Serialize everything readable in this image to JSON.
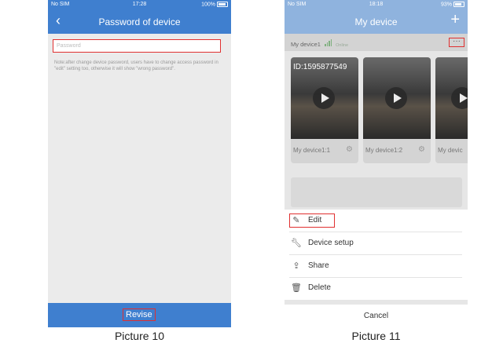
{
  "picture10": {
    "status": {
      "carrier": "No SIM",
      "wifi_icon": "wifi-icon",
      "time": "17:28",
      "battery": "100%"
    },
    "title": "Password of device",
    "back_icon": "chevron-left-icon",
    "password_placeholder": "Password",
    "note": "Note:after change device password, users have to change access password in \"edit\" setting too, otherwise it will show \"wrong password\".",
    "revise_label": "Revise",
    "caption": "Picture 10"
  },
  "picture11": {
    "status": {
      "carrier": "No SIM",
      "wifi_icon": "wifi-icon",
      "time": "18:18",
      "battery": "93%"
    },
    "title": "My device",
    "add_icon": "plus-icon",
    "device_name": "My device1",
    "online": "Online",
    "more_icon": "more-dots-icon",
    "cameras": [
      {
        "id": "ID:1595877549",
        "label": "My device1:1"
      },
      {
        "id": "",
        "label": "My device1:2"
      },
      {
        "id": "",
        "label": "My devic"
      }
    ],
    "menu": [
      {
        "label": "Edit",
        "icon": "pencil-icon"
      },
      {
        "label": "Device setup",
        "icon": "wrench-icon"
      },
      {
        "label": "Share",
        "icon": "share-icon"
      },
      {
        "label": "Delete",
        "icon": "trash-icon"
      }
    ],
    "cancel_label": "Cancel",
    "caption": "Picture 11"
  },
  "colors": {
    "accent": "#3f7fcf",
    "highlight": "#e03030"
  }
}
